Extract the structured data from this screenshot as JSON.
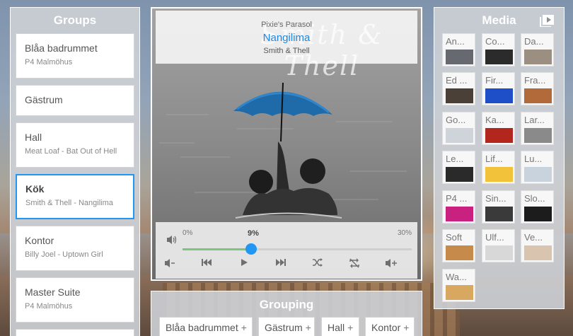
{
  "groups": {
    "title": "Groups",
    "items": [
      {
        "name": "Blåa badrummet",
        "sub": "P4 Malmöhus"
      },
      {
        "name": "Gästrum",
        "sub": ""
      },
      {
        "name": "Hall",
        "sub": "Meat Loaf - Bat Out of Hell"
      },
      {
        "name": "Kök",
        "sub": "Smith & Thell - Nangilima"
      },
      {
        "name": "Kontor",
        "sub": "Billy Joel - Uptown Girl"
      },
      {
        "name": "Master Suite",
        "sub": "P4 Malmöhus"
      },
      {
        "name": "",
        "sub": ""
      }
    ]
  },
  "player": {
    "album": "Pixie's Parasol",
    "title": "Nangilima",
    "artist": "Smith & Thell",
    "watermark": "Smith & Thell",
    "progress": {
      "start_label": "0%",
      "current_label": "9%",
      "end_label": "30%",
      "fraction": 0.3
    },
    "controls": [
      "volume-down",
      "previous",
      "play",
      "next",
      "shuffle",
      "repeat-off",
      "volume-up"
    ]
  },
  "grouping": {
    "title": "Grouping",
    "chips": [
      "Blåa badrummet",
      "Gästrum",
      "Hall",
      "Kontor"
    ],
    "plus": "+"
  },
  "media": {
    "title": "Media",
    "tiles": [
      "An...",
      "Co...",
      "Da...",
      "Ed ...",
      "Fir...",
      "Fra...",
      "Go...",
      "Ka...",
      "Lar...",
      "Le...",
      "Lif...",
      "Lu...",
      "P4 ...",
      "Sin...",
      "Slo...",
      "Soft",
      "Ulf...",
      "Ve...",
      "Wa..."
    ],
    "thumb_colors": [
      "#666a70",
      "#2b2b2b",
      "#9a8f80",
      "#4a4038",
      "#1e4ec8",
      "#b36a3a",
      "#cfd4da",
      "#b3261e",
      "#8a8a8a",
      "#2a2a2a",
      "#f2c23a",
      "#c9d3dd",
      "#c8217f",
      "#3a3a3a",
      "#1c1c1c",
      "#c68a4a",
      "#d8d8d8",
      "#d9c4b0",
      "#d8a860"
    ]
  },
  "colors": {
    "accent": "#2196f3",
    "progress": "#7bc67e",
    "title": "#1e88e5"
  }
}
